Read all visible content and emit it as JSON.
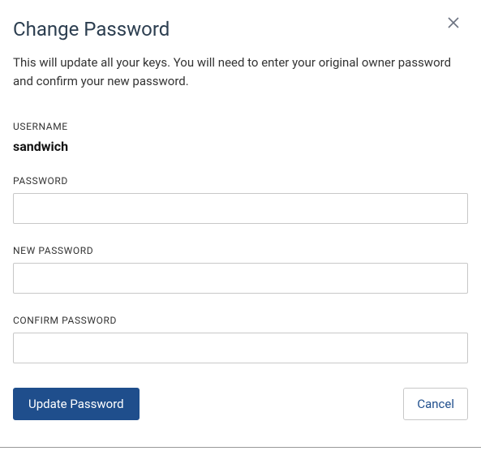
{
  "dialog": {
    "title": "Change Password",
    "description": "This will update all your keys. You will need to enter your original owner password and confirm your new password."
  },
  "fields": {
    "username": {
      "label": "USERNAME",
      "value": "sandwich"
    },
    "password": {
      "label": "PASSWORD",
      "value": ""
    },
    "new_password": {
      "label": "NEW PASSWORD",
      "value": ""
    },
    "confirm_password": {
      "label": "CONFIRM PASSWORD",
      "value": ""
    }
  },
  "buttons": {
    "update": "Update Password",
    "cancel": "Cancel"
  }
}
